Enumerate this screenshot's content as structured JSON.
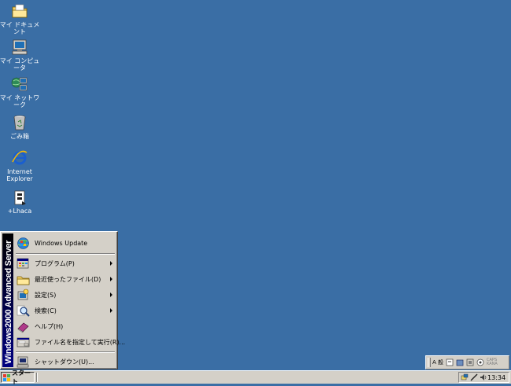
{
  "desktop": {
    "icons": [
      {
        "label": "マイ ドキュメント",
        "icon": "folder-icon"
      },
      {
        "label": "マイ コンピュータ",
        "icon": "computer-icon"
      },
      {
        "label": "マイ ネットワーク",
        "icon": "network-icon"
      },
      {
        "label": "ごみ箱",
        "icon": "recycle-bin-icon"
      },
      {
        "label": "Internet\nExplorer",
        "icon": "ie-icon"
      },
      {
        "label": "+Lhaca",
        "icon": "lhaca-icon"
      }
    ]
  },
  "start_menu": {
    "banner": "Windows2000 Advanced Server",
    "items": [
      {
        "label": "Windows Update",
        "icon": "windows-update-icon",
        "submenu": false
      },
      {
        "label": "プログラム(P)",
        "icon": "programs-icon",
        "submenu": true
      },
      {
        "label": "最近使ったファイル(D)",
        "icon": "documents-folder-icon",
        "submenu": true
      },
      {
        "label": "設定(S)",
        "icon": "settings-icon",
        "submenu": true
      },
      {
        "label": "検索(C)",
        "icon": "search-icon",
        "submenu": true
      },
      {
        "label": "ヘルプ(H)",
        "icon": "help-book-icon",
        "submenu": false
      },
      {
        "label": "ファイル名を指定して実行(R)...",
        "icon": "run-icon",
        "submenu": false
      },
      {
        "label": "シャットダウン(U)...",
        "icon": "shutdown-icon",
        "submenu": false
      }
    ]
  },
  "taskbar": {
    "start_label": "スタート",
    "clock": "13:34"
  },
  "langbar": {
    "text": "A 般",
    "caption": "CAPS\nKANA"
  },
  "colors": {
    "desktop": "#3a6ea5",
    "face": "#d4d0c8",
    "banner": "#000080"
  }
}
